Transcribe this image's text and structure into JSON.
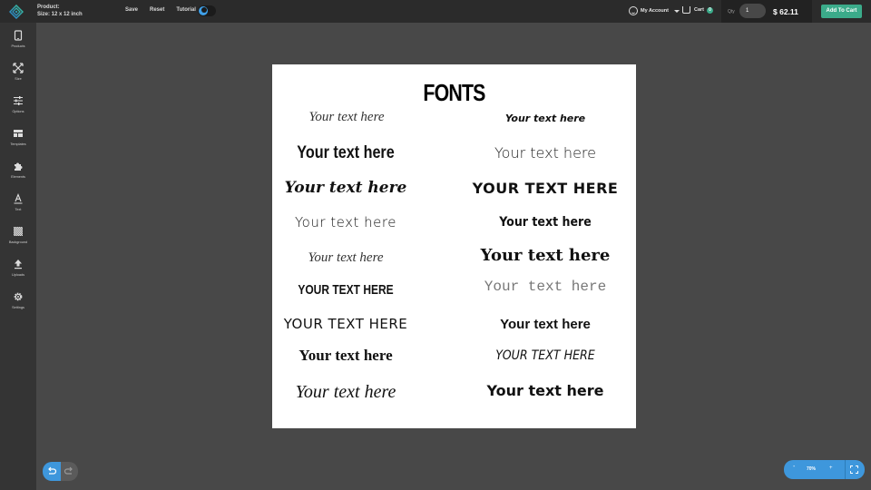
{
  "header": {
    "product_label": "Product:",
    "size_label": "Size: 12 x 12 inch",
    "actions": [
      "Save",
      "Reset",
      "Tutorial"
    ],
    "theme_toggle": "dark-mode-toggle",
    "account_label": "My Account",
    "cart_label": "Cart",
    "cart_count": "0",
    "qty_label": "Qty",
    "qty_value": "1",
    "price": "$ 62.11",
    "add_to_cart": "Add To Cart"
  },
  "sidebar": {
    "items": [
      {
        "label": "Products",
        "icon": "tablet-icon"
      },
      {
        "label": "Size",
        "icon": "resize-icon"
      },
      {
        "label": "Options",
        "icon": "sliders-icon"
      },
      {
        "label": "Templates",
        "icon": "template-icon"
      },
      {
        "label": "Elements",
        "icon": "puzzle-icon"
      },
      {
        "label": "Text",
        "icon": "text-icon"
      },
      {
        "label": "Background",
        "icon": "background-icon"
      },
      {
        "label": "Uploads",
        "icon": "upload-icon"
      },
      {
        "label": "Settings",
        "icon": "gear-icon"
      }
    ]
  },
  "canvas": {
    "title": "FONTS",
    "samples": [
      {
        "text": "Your text here",
        "col": "left"
      },
      {
        "text": "Your text here",
        "col": "right"
      },
      {
        "text": "Your text here",
        "col": "left"
      },
      {
        "text": "Your text here",
        "col": "right"
      },
      {
        "text": "Your text here",
        "col": "left"
      },
      {
        "text": "YOUR TEXT HERE",
        "col": "right"
      },
      {
        "text": "Your text here",
        "col": "left"
      },
      {
        "text": "Your text here",
        "col": "right"
      },
      {
        "text": "Your text here",
        "col": "left"
      },
      {
        "text": "Your text here",
        "col": "right"
      },
      {
        "text": "YOUR TEXT HERE",
        "col": "left"
      },
      {
        "text": "Your text here",
        "col": "right"
      },
      {
        "text": "YOUR TEXT HERE",
        "col": "left"
      },
      {
        "text": "Your text here",
        "col": "right"
      },
      {
        "text": "Your text here",
        "col": "left"
      },
      {
        "text": "YOUR TEXT HERE",
        "col": "right"
      },
      {
        "text": "Your text here",
        "col": "left"
      },
      {
        "text": "Your text here",
        "col": "right"
      }
    ]
  },
  "zoom": {
    "minus": "-",
    "level": "70%",
    "plus": "+"
  },
  "colors": {
    "accent_blue": "#3e97dc",
    "accent_green": "#3bab8a"
  }
}
